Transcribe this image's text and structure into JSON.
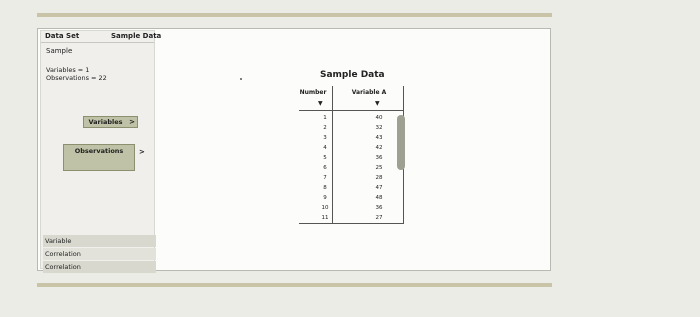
{
  "sidebar": {
    "header_left": "Data Set",
    "header_right": "Sample Data",
    "sample_label": "Sample",
    "variables_stat": "Variables = 1",
    "observations_stat": "Observations = 22",
    "variables_button": "Variables",
    "observations_button": "Observations",
    "chevron": ">",
    "sub_items": [
      "Variable",
      "Correlation",
      "Correlation"
    ]
  },
  "main": {
    "title": "Sample Data",
    "columns": [
      "Number",
      "Variable A"
    ],
    "sort_glyph": "▼",
    "rows": [
      [
        "1",
        "40"
      ],
      [
        "2",
        "32"
      ],
      [
        "3",
        "43"
      ],
      [
        "4",
        "42"
      ],
      [
        "5",
        "36"
      ],
      [
        "6",
        "25"
      ],
      [
        "7",
        "28"
      ],
      [
        "8",
        "47"
      ],
      [
        "9",
        "48"
      ],
      [
        "10",
        "36"
      ],
      [
        "11",
        "27"
      ]
    ]
  },
  "colors": {
    "button_bg": "#bfc2a6",
    "rule": "#c9c3a8",
    "scroll_thumb": "#9ea091"
  }
}
